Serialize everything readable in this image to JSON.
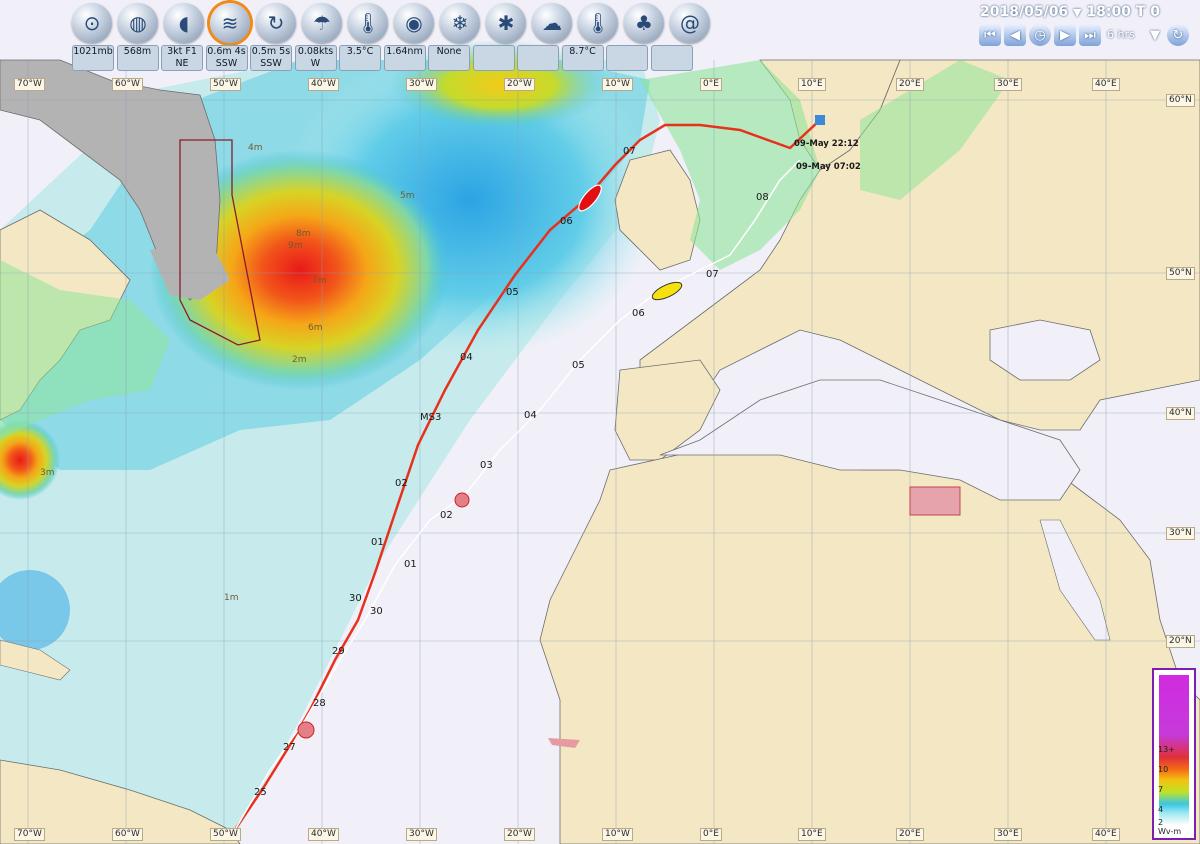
{
  "header": {
    "date": "2018/05/06",
    "time": "18:00 T 0",
    "interval": "6 hrs"
  },
  "toolbar_icons": [
    {
      "name": "barometer-icon",
      "glyph": "⊙"
    },
    {
      "name": "globe-icon",
      "glyph": "◍"
    },
    {
      "name": "wind-horn-icon",
      "glyph": "◖"
    },
    {
      "name": "waves-icon",
      "glyph": "≋"
    },
    {
      "name": "current-icon",
      "glyph": "↻"
    },
    {
      "name": "cloud-rain-icon",
      "glyph": "☂"
    },
    {
      "name": "thermometer-icon",
      "glyph": "🌡"
    },
    {
      "name": "visibility-icon",
      "glyph": "◉"
    },
    {
      "name": "ice-icon",
      "glyph": "❄"
    },
    {
      "name": "snowflake-icon",
      "glyph": "✱"
    },
    {
      "name": "cloud-icon",
      "glyph": "☁"
    },
    {
      "name": "sea-temp-icon",
      "glyph": "🌡"
    },
    {
      "name": "trees-icon",
      "glyph": "♣"
    },
    {
      "name": "spiral-icon",
      "glyph": "@"
    }
  ],
  "readouts": [
    {
      "name": "pressure",
      "line1": "1021mb",
      "line2": ""
    },
    {
      "name": "height",
      "line1": "568m",
      "line2": ""
    },
    {
      "name": "wind",
      "line1": "3kt F1",
      "line2": "NE"
    },
    {
      "name": "wave",
      "line1": "0.6m 4s",
      "line2": "SSW"
    },
    {
      "name": "swell",
      "line1": "0.5m 5s",
      "line2": "SSW"
    },
    {
      "name": "current",
      "line1": "0.08kts",
      "line2": "W"
    },
    {
      "name": "air-temp",
      "line1": "3.5°C",
      "line2": ""
    },
    {
      "name": "visibility",
      "line1": "1.64nm",
      "line2": ""
    },
    {
      "name": "ice",
      "line1": "None",
      "line2": ""
    },
    {
      "name": "blank1",
      "line1": "",
      "line2": ""
    },
    {
      "name": "blank2",
      "line1": "",
      "line2": ""
    },
    {
      "name": "sea-temp",
      "line1": "8.7°C",
      "line2": ""
    },
    {
      "name": "blank3",
      "line1": "",
      "line2": ""
    },
    {
      "name": "blank4",
      "line1": "",
      "line2": ""
    }
  ],
  "map": {
    "lon_labels": [
      "70°W",
      "60°W",
      "50°W",
      "40°W",
      "30°W",
      "20°W",
      "10°W",
      "0°E",
      "10°E",
      "20°E",
      "30°E",
      "40°E"
    ],
    "lat_labels": [
      "60°N",
      "50°N",
      "40°N",
      "30°N",
      "20°N"
    ],
    "route_labels_red": [
      "25",
      "27",
      "28",
      "29",
      "30",
      "01",
      "02",
      "MS3",
      "04",
      "05",
      "06",
      "07"
    ],
    "route_labels_white": [
      "30",
      "01",
      "02",
      "03",
      "04",
      "05",
      "06",
      "07",
      "08"
    ],
    "waypoints": [
      {
        "label": "09-May 22:12"
      },
      {
        "label": "09-May 07:02"
      }
    ],
    "wave_contours": [
      "9m",
      "8m",
      "7m",
      "6m",
      "5m",
      "4m",
      "3m",
      "2m",
      "1m"
    ],
    "colors": {
      "land": "#f4e7c4",
      "sea": "#f2f0fa",
      "route_red": "#e8311d",
      "route_white": "#ffffff"
    }
  },
  "legend": {
    "ticks": [
      "13+",
      "10",
      "7",
      "4",
      "2"
    ],
    "unit": "Wv-m"
  },
  "navigation": {
    "buttons": [
      "first",
      "prev",
      "clock",
      "next",
      "last",
      "dropdown",
      "refresh"
    ]
  }
}
